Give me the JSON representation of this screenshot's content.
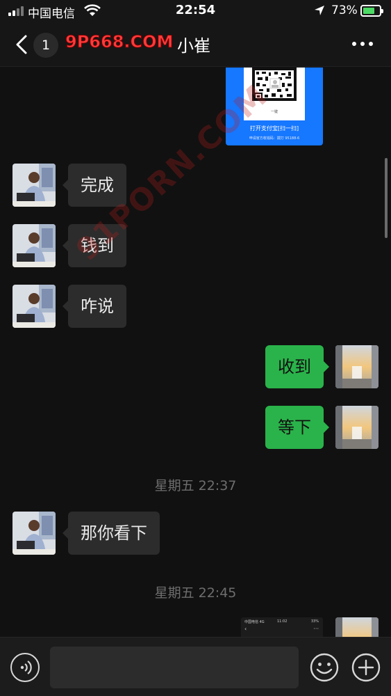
{
  "status_bar": {
    "carrier": "中国电信",
    "time": "22:54",
    "battery_percent": "73%",
    "battery_level": 0.73
  },
  "nav": {
    "unread_count": "1",
    "watermark_logo": "9P668.COM",
    "title": "小崔",
    "back_icon": "chevron-left-icon",
    "more_icon": "more-icon"
  },
  "qr_card": {
    "caption": "打开支付宝[扫一扫]",
    "subcaption": "申请官方收钱码：拨打 95188-6",
    "qr_label": "一键"
  },
  "messages": [
    {
      "side": "in",
      "text": "完成"
    },
    {
      "side": "in",
      "text": "钱到"
    },
    {
      "side": "in",
      "text": "咋说"
    },
    {
      "side": "out",
      "text": "收到"
    },
    {
      "side": "out",
      "text": "等下"
    },
    {
      "side": "time",
      "text": "星期五 22:37"
    },
    {
      "side": "in",
      "text": "那你看下"
    },
    {
      "side": "time",
      "text": "星期五 22:45"
    }
  ],
  "screenshot_thumb": {
    "carrier": "中国电信 4G",
    "time": "11:02",
    "battery": "33%"
  },
  "watermark_text": "91PORN.COM",
  "input_bar": {
    "placeholder": "",
    "voice_icon": "voice-icon",
    "emoji_icon": "emoji-icon",
    "add_icon": "plus-icon"
  },
  "colors": {
    "background": "#111111",
    "incoming_bubble": "#2c2c2c",
    "outgoing_bubble": "#2ab34a",
    "alipay_blue": "#1677ff"
  }
}
